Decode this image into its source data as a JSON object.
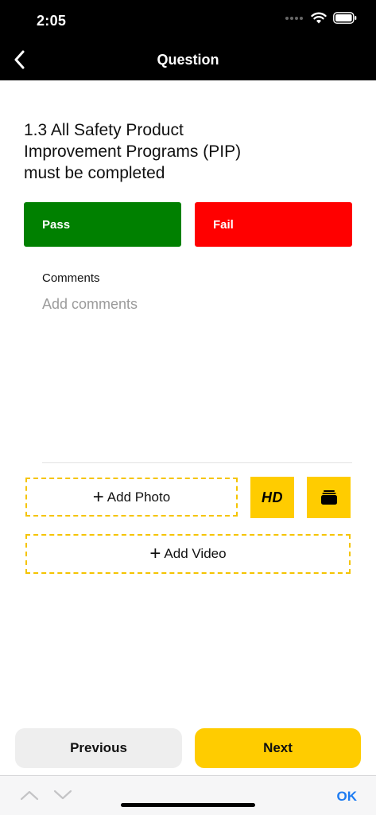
{
  "status": {
    "time": "2:05"
  },
  "nav": {
    "title": "Question"
  },
  "question": {
    "text": "1.3 All Safety Product Improvement Programs (PIP) must be completed"
  },
  "choices": {
    "pass": "Pass",
    "fail": "Fail"
  },
  "comments": {
    "label": "Comments",
    "placeholder": "Add comments",
    "value": ""
  },
  "media": {
    "add_photo": "Add Photo",
    "hd": "HD",
    "add_video": "Add Video"
  },
  "footer": {
    "previous": "Previous",
    "next": "Next"
  },
  "keyboard_toolbar": {
    "ok": "OK"
  },
  "colors": {
    "pass": "#008000",
    "fail": "#ff0000",
    "accent": "#ffcc00",
    "link": "#1e7cf2"
  }
}
